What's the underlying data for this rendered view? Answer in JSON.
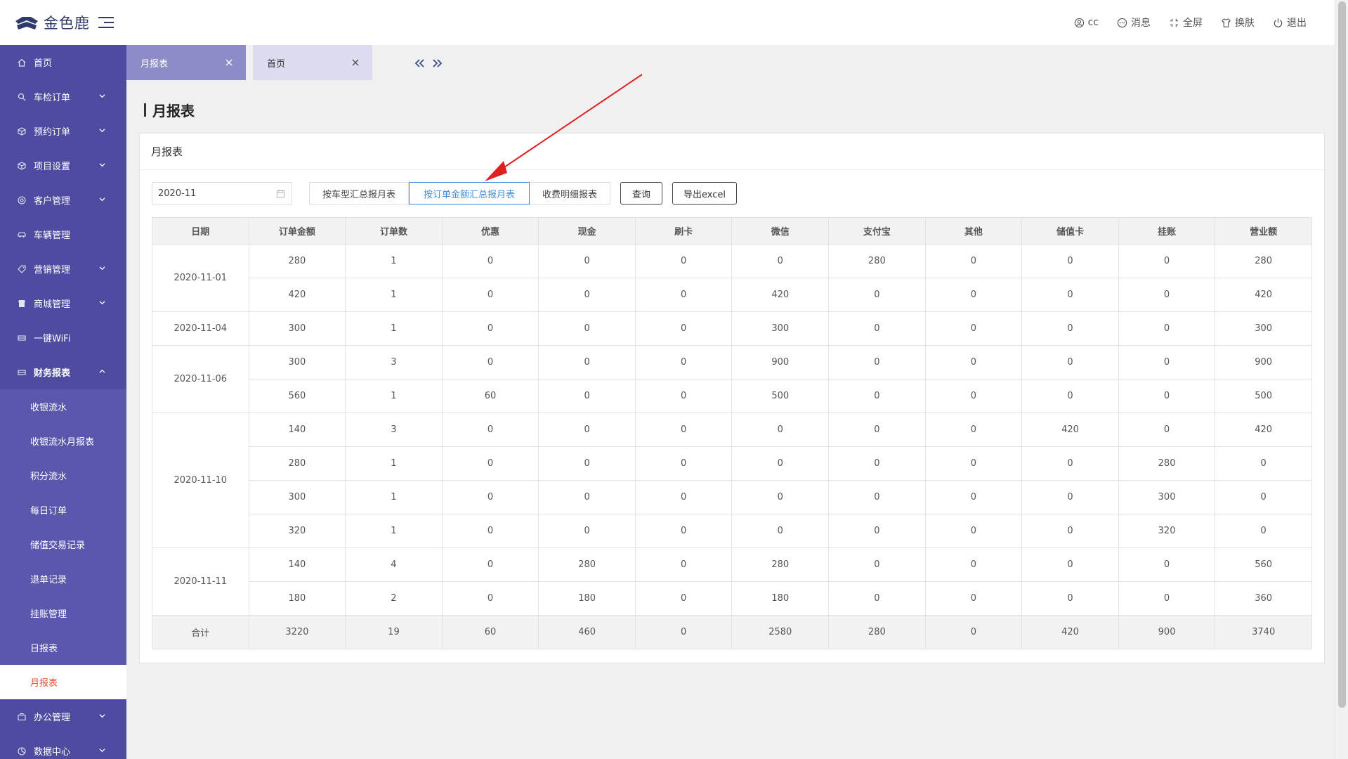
{
  "app": {
    "brand": "金色鹿"
  },
  "header": {
    "user": "cc",
    "messages": "消息",
    "fullscreen": "全屏",
    "skin": "换肤",
    "logout": "退出"
  },
  "sidebar": {
    "items": [
      {
        "label": "首页",
        "icon": "home-icon"
      },
      {
        "label": "车检订单",
        "icon": "search-icon"
      },
      {
        "label": "预约订单",
        "icon": "box-icon"
      },
      {
        "label": "项目设置",
        "icon": "box-icon"
      },
      {
        "label": "客户管理",
        "icon": "target-icon"
      },
      {
        "label": "车辆管理",
        "icon": "car-icon"
      },
      {
        "label": "营销管理",
        "icon": "tag-icon"
      },
      {
        "label": "商城管理",
        "icon": "shop-icon"
      },
      {
        "label": "一键WiFi",
        "icon": "wifi-icon"
      },
      {
        "label": "财务报表",
        "icon": "card-icon"
      }
    ],
    "finance_sub": [
      "收银流水",
      "收银流水月报表",
      "积分流水",
      "每日订单",
      "储值交易记录",
      "退单记录",
      "挂账管理",
      "日报表",
      "月报表"
    ],
    "bottom_items": [
      {
        "label": "办公管理",
        "icon": "briefcase-icon"
      },
      {
        "label": "数据中心",
        "icon": "chart-icon"
      }
    ]
  },
  "tabs": [
    {
      "label": "月报表",
      "active": true
    },
    {
      "label": "首页",
      "active": false
    }
  ],
  "page": {
    "heading": "月报表",
    "card_title": "月报表",
    "month_value": "2020-11",
    "report_types": [
      "按车型汇总报月表",
      "按订单金额汇总报月表",
      "收费明细报表"
    ],
    "selected_report_type": "按订单金额汇总报月表",
    "query_button": "查询",
    "export_button": "导出excel"
  },
  "table": {
    "columns": [
      "日期",
      "订单金额",
      "订单数",
      "优惠",
      "现金",
      "刷卡",
      "微信",
      "支付宝",
      "其他",
      "储值卡",
      "挂账",
      "营业额"
    ],
    "groups": [
      {
        "date": "2020-11-01",
        "rows": [
          [
            "280",
            "1",
            "0",
            "0",
            "0",
            "0",
            "280",
            "0",
            "0",
            "0",
            "280"
          ],
          [
            "420",
            "1",
            "0",
            "0",
            "0",
            "420",
            "0",
            "0",
            "0",
            "0",
            "420"
          ]
        ]
      },
      {
        "date": "2020-11-04",
        "rows": [
          [
            "300",
            "1",
            "0",
            "0",
            "0",
            "300",
            "0",
            "0",
            "0",
            "0",
            "300"
          ]
        ]
      },
      {
        "date": "2020-11-06",
        "rows": [
          [
            "300",
            "3",
            "0",
            "0",
            "0",
            "900",
            "0",
            "0",
            "0",
            "0",
            "900"
          ],
          [
            "560",
            "1",
            "60",
            "0",
            "0",
            "500",
            "0",
            "0",
            "0",
            "0",
            "500"
          ]
        ]
      },
      {
        "date": "2020-11-10",
        "rows": [
          [
            "140",
            "3",
            "0",
            "0",
            "0",
            "0",
            "0",
            "0",
            "420",
            "0",
            "420"
          ],
          [
            "280",
            "1",
            "0",
            "0",
            "0",
            "0",
            "0",
            "0",
            "0",
            "280",
            "0"
          ],
          [
            "300",
            "1",
            "0",
            "0",
            "0",
            "0",
            "0",
            "0",
            "0",
            "300",
            "0"
          ],
          [
            "320",
            "1",
            "0",
            "0",
            "0",
            "0",
            "0",
            "0",
            "0",
            "320",
            "0"
          ]
        ]
      },
      {
        "date": "2020-11-11",
        "rows": [
          [
            "140",
            "4",
            "0",
            "280",
            "0",
            "280",
            "0",
            "0",
            "0",
            "0",
            "560"
          ],
          [
            "180",
            "2",
            "0",
            "180",
            "0",
            "180",
            "0",
            "0",
            "0",
            "0",
            "360"
          ]
        ]
      }
    ],
    "total": [
      "合计",
      "3220",
      "19",
      "60",
      "460",
      "0",
      "2580",
      "280",
      "0",
      "420",
      "900",
      "3740"
    ]
  },
  "colors": {
    "sidebar": "#4e4ba0",
    "sidebar_sub": "#5a57ad",
    "active_link": "#e8542e",
    "accent": "#3a8ee6",
    "annotation_arrow": "#e02020"
  }
}
